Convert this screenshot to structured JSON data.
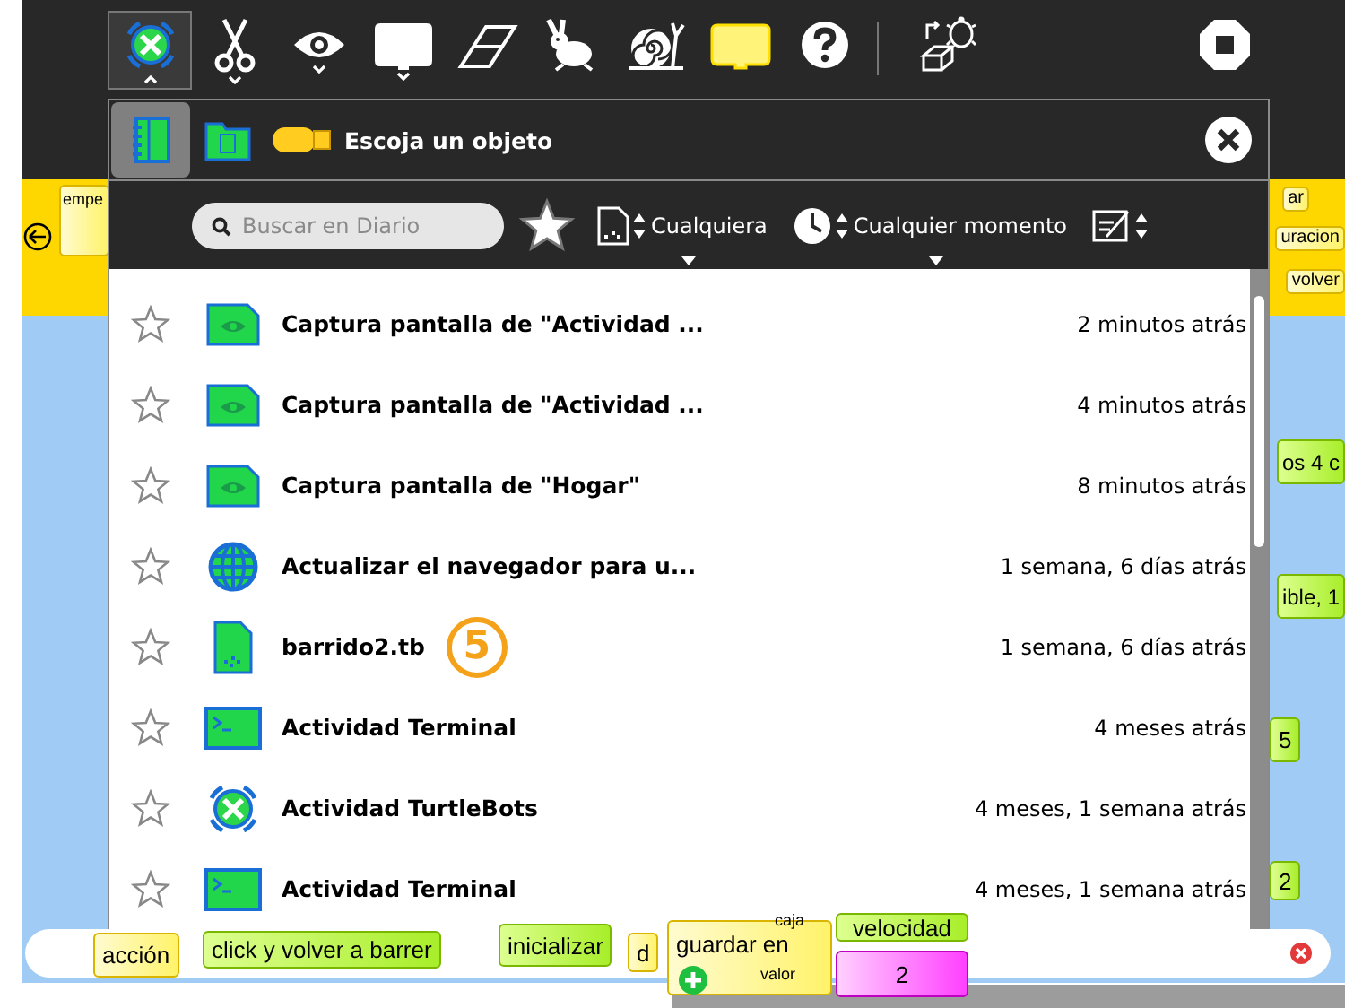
{
  "toolbar": {
    "items": [
      {
        "kind": "activity",
        "selected": true,
        "menu": true
      },
      {
        "kind": "scissors",
        "selected": false,
        "menu": true
      },
      {
        "kind": "eye",
        "selected": false,
        "menu": true
      },
      {
        "kind": "palette",
        "selected": false,
        "menu": true
      },
      {
        "kind": "eraser",
        "selected": false,
        "menu": false
      },
      {
        "kind": "rabbit",
        "selected": false,
        "menu": false
      },
      {
        "kind": "snail",
        "selected": false,
        "menu": false
      },
      {
        "kind": "step",
        "selected": false,
        "menu": false
      },
      {
        "kind": "help",
        "selected": false,
        "menu": false
      },
      {
        "kind": "separator"
      },
      {
        "kind": "load",
        "selected": false,
        "menu": false
      },
      {
        "kind": "stop",
        "selected": false,
        "menu": false
      }
    ]
  },
  "canvas": {
    "blocks": [
      {
        "text": "empe",
        "kind": "flow"
      },
      {
        "text": "ar",
        "kind": "flow"
      },
      {
        "text": "uracion",
        "kind": "flow"
      },
      {
        "text": "volver",
        "kind": "flow"
      },
      {
        "text": "os 4 c",
        "kind": "string"
      },
      {
        "text": "ible, 1",
        "kind": "string"
      },
      {
        "text": "5",
        "kind": "string"
      },
      {
        "text": "2",
        "kind": "string"
      },
      {
        "text": "acción",
        "kind": "flow"
      },
      {
        "text": "click y volver a barrer",
        "kind": "string"
      },
      {
        "text": "inicializar",
        "kind": "string"
      },
      {
        "text": "d",
        "kind": "flow"
      },
      {
        "text": "guardar en",
        "kind": "flow"
      },
      {
        "text": "caja",
        "kind": "label"
      },
      {
        "text": "valor",
        "kind": "label"
      },
      {
        "text": "velocidad",
        "kind": "string"
      },
      {
        "text": "2",
        "kind": "value"
      }
    ]
  },
  "journal": {
    "tabs": [
      {
        "kind": "journal",
        "selected": true
      },
      {
        "kind": "documents",
        "selected": false
      },
      {
        "kind": "usb",
        "selected": false
      }
    ],
    "title": "Escoja un objeto",
    "search": {
      "placeholder": "Buscar en Diario"
    },
    "filters": [
      {
        "kind": "type",
        "label": "Cualquiera"
      },
      {
        "kind": "time",
        "label": "Cualquier momento"
      },
      {
        "kind": "sort"
      }
    ],
    "entries": [
      {
        "kind": "screenshot",
        "starred": false,
        "title": "Captura pantalla de \"Actividad ...",
        "time": "2 minutos atrás"
      },
      {
        "kind": "screenshot",
        "starred": false,
        "title": "Captura pantalla de \"Actividad ...",
        "time": "4 minutos atrás"
      },
      {
        "kind": "screenshot",
        "starred": false,
        "title": "Captura pantalla de \"Hogar\"",
        "time": "8 minutos atrás"
      },
      {
        "kind": "browser",
        "starred": false,
        "title": "Actualizar el navegador para u...",
        "time": "1 semana, 6 días atrás"
      },
      {
        "kind": "file",
        "starred": false,
        "title": "barrido2.tb",
        "time": "1 semana, 6 días atrás",
        "badge": "5"
      },
      {
        "kind": "terminal",
        "starred": false,
        "title": "Actividad Terminal",
        "time": "4 meses atrás"
      },
      {
        "kind": "turtlebots",
        "starred": false,
        "title": "Actividad TurtleBots",
        "time": "4 meses, 1 semana atrás"
      },
      {
        "kind": "terminal",
        "starred": false,
        "title": "Actividad Terminal",
        "time": "4 meses, 1 semana atrás"
      }
    ]
  }
}
